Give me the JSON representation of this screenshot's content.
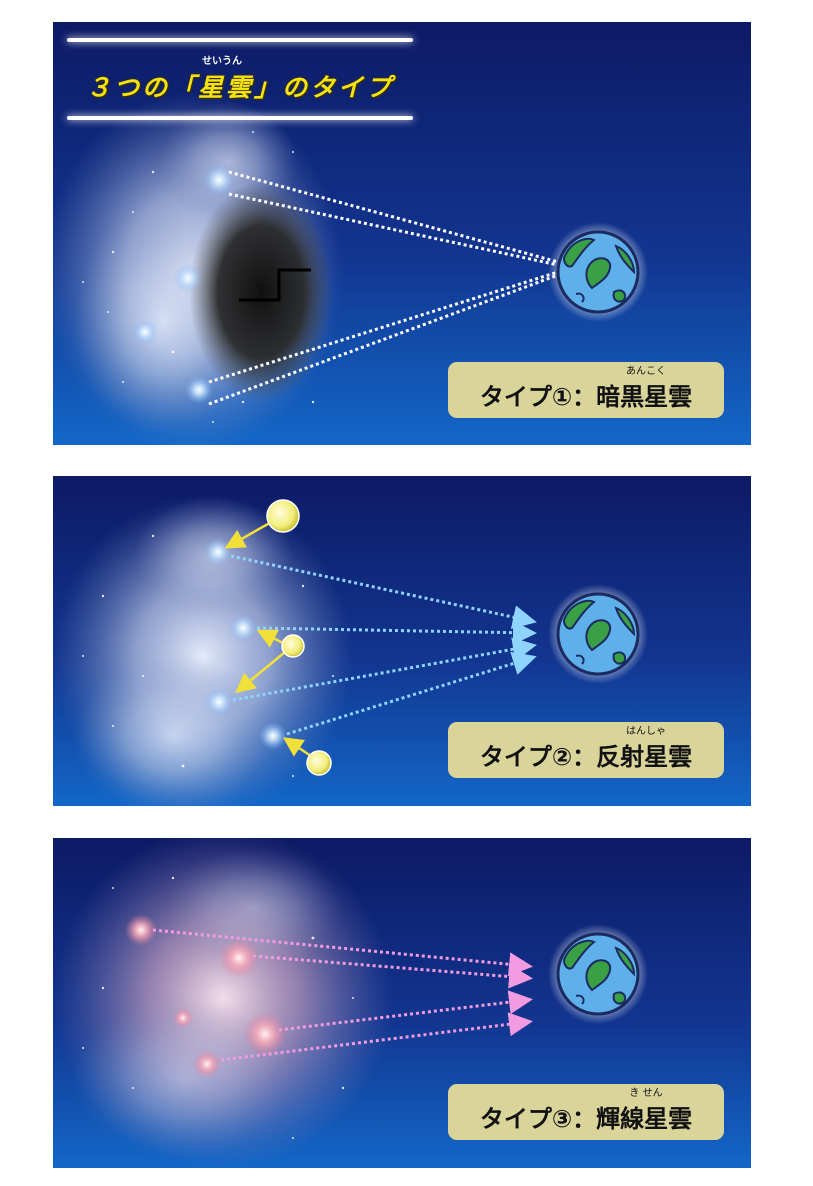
{
  "title": {
    "text": "３つの「星雲」のタイプ",
    "ruby": "せいうん"
  },
  "panels": [
    {
      "label": "タイプ①：暗黒星雲",
      "ruby": "あんこく"
    },
    {
      "label": "タイプ②：反射星雲",
      "ruby": "はんしゃ"
    },
    {
      "label": "タイプ③：輝線星雲",
      "ruby": "き せん"
    }
  ],
  "icons": [
    "earth-icon",
    "star-icon",
    "nebula"
  ],
  "colors": {
    "background": "#0d1f6e",
    "background_bottom": "#1366c9",
    "title_text": "#f5e214",
    "label_box": "#d9d49a",
    "arrow_dark": "#ffffff",
    "arrow_reflection": "#8fd3ff",
    "arrow_emission": "#f29be0",
    "star_light": "#f2ee7a",
    "earth_ocean": "#5fb0ea",
    "earth_land": "#3aa046"
  }
}
